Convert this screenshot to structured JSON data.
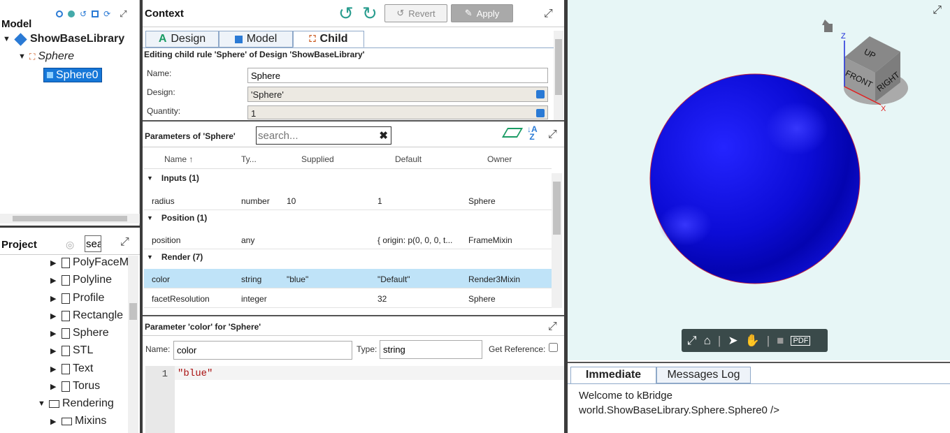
{
  "model_panel": {
    "title": "Model",
    "tree": [
      {
        "label": "ShowBaseLibrary"
      },
      {
        "label": "Sphere"
      },
      {
        "label": "Sphere0"
      }
    ]
  },
  "project_panel": {
    "title": "Project",
    "search_value": "sea",
    "items": [
      "PolyFaceM",
      "Polyline",
      "Profile",
      "Rectangle",
      "Sphere",
      "STL",
      "Text",
      "Torus",
      "Rendering",
      "Mixins"
    ]
  },
  "context": {
    "title": "Context",
    "revert_label": "Revert",
    "apply_label": "Apply",
    "tabs": [
      {
        "label": "Design"
      },
      {
        "label": "Model"
      },
      {
        "label": "Child"
      }
    ],
    "editing_text": "Editing child rule 'Sphere' of Design 'ShowBaseLibrary'",
    "fields": {
      "name_label": "Name:",
      "name_value": "Sphere",
      "design_label": "Design:",
      "design_value": "'Sphere'",
      "quantity_label": "Quantity:",
      "quantity_value": "1"
    }
  },
  "params": {
    "title": "Parameters of 'Sphere'",
    "search_placeholder": "search...",
    "columns": [
      "Name ↑",
      "Ty...",
      "Supplied",
      "Default",
      "Owner"
    ],
    "groups": [
      {
        "label": "Inputs (1)",
        "rows": [
          {
            "name": "radius",
            "type": "number",
            "supplied": "10",
            "default": "1",
            "owner": "Sphere"
          }
        ]
      },
      {
        "label": "Position (1)",
        "rows": [
          {
            "name": "position",
            "type": "any",
            "supplied": "",
            "default": "{ origin: p(0, 0, 0, t...",
            "owner": "FrameMixin"
          }
        ]
      },
      {
        "label": "Render (7)",
        "rows": [
          {
            "name": "color",
            "type": "string",
            "supplied": "\"blue\"",
            "default": "\"Default\"",
            "owner": "Render3Mixin"
          },
          {
            "name": "facetResolution",
            "type": "integer",
            "supplied": "",
            "default": "32",
            "owner": "Sphere"
          }
        ]
      }
    ]
  },
  "editor": {
    "title": "Parameter 'color' for 'Sphere'",
    "name_label": "Name:",
    "name_value": "color",
    "type_label": "Type:",
    "type_value": "string",
    "get_reference_label": "Get Reference:",
    "line_number": "1",
    "code": "\"blue\""
  },
  "viewport": {
    "cube": {
      "up": "UP",
      "front": "FRONT",
      "right": "RIGHT"
    },
    "axis_z": "Z",
    "axis_x": "X",
    "sphere_color": "#0a0ad8"
  },
  "immediate": {
    "tabs": [
      {
        "label": "Immediate"
      },
      {
        "label": "Messages Log"
      }
    ],
    "lines": [
      "Welcome to kBridge",
      "world.ShowBaseLibrary.Sphere.Sphere0 />"
    ]
  },
  "colors": {
    "accent": "#2a7ad5",
    "selected_row": "#bfe3f8",
    "toolbar_dark": "#3a4a4a"
  }
}
